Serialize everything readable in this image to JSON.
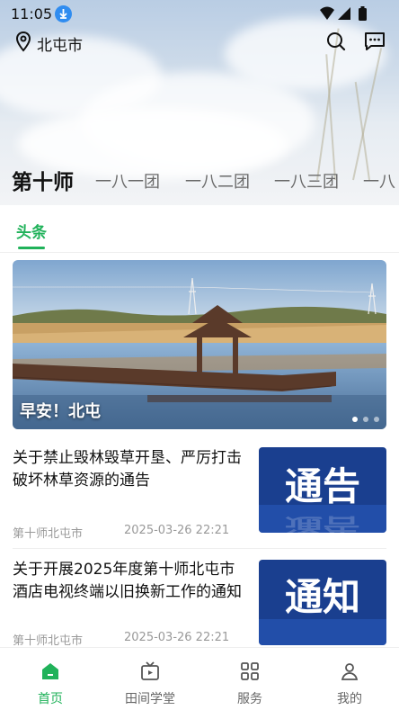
{
  "status_bar": {
    "time": "11:05"
  },
  "header": {
    "location": "北屯市"
  },
  "tabs": [
    {
      "label": "第十师"
    },
    {
      "label": "一八一团"
    },
    {
      "label": "一八二团"
    },
    {
      "label": "一八三团"
    },
    {
      "label": "一八"
    }
  ],
  "subtab": {
    "label": "头条"
  },
  "banner": {
    "caption": "早安！北屯",
    "page_count": 3,
    "active_page": 1
  },
  "news": [
    {
      "title": "关于禁止毁林毁草开垦、严厉打击破坏林草资源的通告",
      "source": "第十师北屯市",
      "date": "2025-03-26 22:21",
      "thumb_text": "通告"
    },
    {
      "title": "关于开展2025年度第十师北屯市酒店电视终端以旧换新工作的通知",
      "source": "第十师北屯市",
      "date": "2025-03-26 22:21",
      "thumb_text": "通知"
    }
  ],
  "bottom_nav": [
    {
      "label": "首页",
      "icon": "home-icon",
      "active": true
    },
    {
      "label": "田间学堂",
      "icon": "tv-icon",
      "active": false
    },
    {
      "label": "服务",
      "icon": "grid-icon",
      "active": false
    },
    {
      "label": "我的",
      "icon": "person-icon",
      "active": false
    }
  ],
  "colors": {
    "accent": "#20b25a",
    "thumb_blue": "#1a3f8f"
  }
}
